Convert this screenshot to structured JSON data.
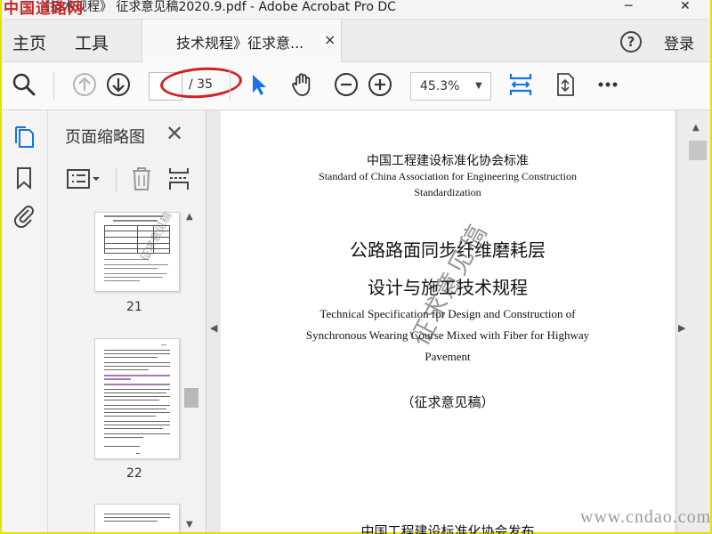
{
  "window": {
    "title": "《技术规程》 征求意见稿2020.9.pdf - Adobe Acrobat Pro DC",
    "watermark": "中国道路网",
    "minimize": "─",
    "close": "✕"
  },
  "menu": {
    "home": "主页",
    "tools": "工具"
  },
  "tab": {
    "label": "技术规程》征求意...",
    "close": "×"
  },
  "header_right": {
    "help": "?",
    "login": "登录"
  },
  "toolbar": {
    "page_total": "/ 35",
    "zoom": "45.3%"
  },
  "panel": {
    "title": "页面缩略图",
    "close": "✕",
    "thumbnails": [
      {
        "number": "21"
      },
      {
        "number": "22"
      }
    ],
    "thumb_stamp": "征求意见稿"
  },
  "document": {
    "org_cn": "中国工程建设标准化协会标准",
    "org_en_line1": "Standard of China Association for Engineering Construction",
    "org_en_line2": "Standardization",
    "title_cn_line1": "公路路面同步纤维磨耗层",
    "title_cn_line2": "设计与施工技术规程",
    "title_en_line1": "Technical Specification for Design and Construction of",
    "title_en_line2": "Synchronous Wearing Course Mixed with Fiber for Highway",
    "title_en_line3": "Pavement",
    "status": "（征求意见稿）",
    "publisher": "中国工程建设标准化协会发布",
    "stamp": "征求意见稿"
  },
  "site_watermark": "www.cndao.com",
  "colors": {
    "accent": "#1473e6",
    "oval": "#d32020",
    "frame": "#e8e000"
  }
}
